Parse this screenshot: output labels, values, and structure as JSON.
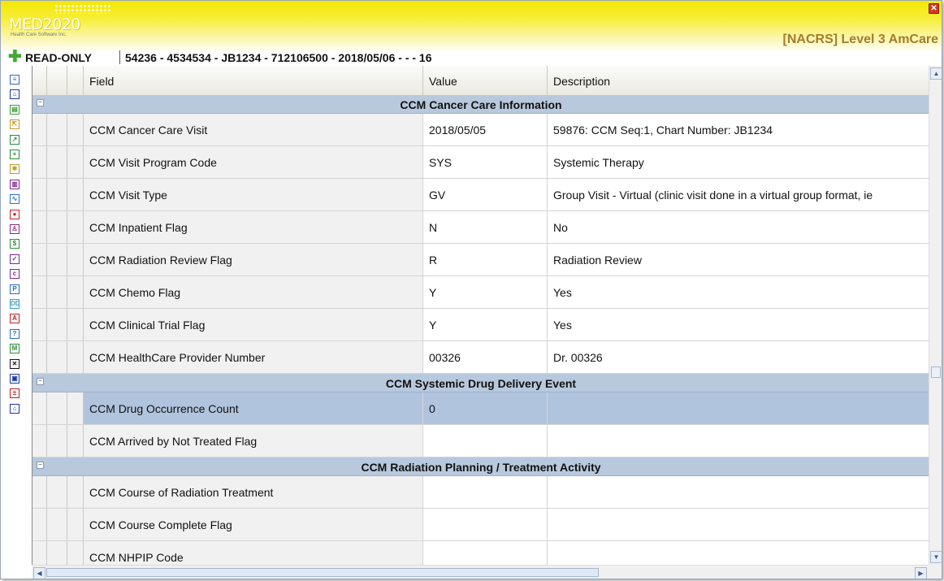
{
  "app": {
    "logo_name": "MED2020",
    "logo_sub": "Health Care Software Inc.",
    "title": "[NACRS] Level 3 AmCare",
    "mode": "READ-ONLY",
    "record_ids": "54236 - 4534534 - JB1234 - 712106500 - 2018/05/06 - - - 16",
    "close_glyph": "✕",
    "add_glyph": "✚"
  },
  "toolbar": {
    "icons": [
      {
        "name": "list-icon",
        "glyph": "≡",
        "color": "#2a6ebb"
      },
      {
        "name": "home-icon",
        "glyph": "⌂",
        "color": "#1e3c9a"
      },
      {
        "name": "map-icon",
        "glyph": "▤",
        "color": "#3f9e3a"
      },
      {
        "name": "export-icon",
        "glyph": "⇱",
        "color": "#c59a21"
      },
      {
        "name": "arrow-icon",
        "glyph": "↗",
        "color": "#2e8b3e"
      },
      {
        "name": "plus-icon",
        "glyph": "+",
        "color": "#2e8b3e"
      },
      {
        "name": "puzzle-icon",
        "glyph": "✱",
        "color": "#b3a238"
      },
      {
        "name": "chart-icon",
        "glyph": "▥",
        "color": "#7b2d8d"
      },
      {
        "name": "wave-icon",
        "glyph": "∿",
        "color": "#2f6fcf"
      },
      {
        "name": "drop-icon",
        "glyph": "●",
        "color": "#cc2222"
      },
      {
        "name": "person-icon",
        "glyph": "♙",
        "color": "#8c2a7a"
      },
      {
        "name": "dollar-icon",
        "glyph": "$",
        "color": "#2e8b3e"
      },
      {
        "name": "check-icon",
        "glyph": "✓",
        "color": "#7b2d8d"
      },
      {
        "name": "c-icon",
        "glyph": "c",
        "color": "#7b2d8d"
      },
      {
        "name": "p-icon",
        "glyph": "P",
        "color": "#2a6ebb"
      },
      {
        "name": "dd-icon",
        "glyph": "DD",
        "color": "#3ba5c8"
      },
      {
        "name": "a-icon",
        "glyph": "A",
        "color": "#c22222"
      },
      {
        "name": "help-icon",
        "glyph": "?",
        "color": "#2a6ebb"
      },
      {
        "name": "m-icon",
        "glyph": "M",
        "color": "#2e8b3e"
      },
      {
        "name": "x-icon",
        "glyph": "✕",
        "color": "#111111"
      },
      {
        "name": "doc-icon",
        "glyph": "▣",
        "color": "#1e3c9a"
      },
      {
        "name": "plusminus-icon",
        "glyph": "±",
        "color": "#c22222"
      },
      {
        "name": "house-icon",
        "glyph": "⌂",
        "color": "#1e3c9a"
      }
    ]
  },
  "grid": {
    "columns": {
      "field": "Field",
      "value": "Value",
      "description": "Description"
    },
    "group_toggle": "−",
    "groups": [
      {
        "title": "CCM Cancer Care Information",
        "rows": [
          {
            "field": "CCM Cancer Care Visit",
            "value": "2018/05/05",
            "desc": "59876: CCM  Seq:1, Chart Number: JB1234"
          },
          {
            "field": "CCM Visit Program Code",
            "value": "SYS",
            "desc": "Systemic Therapy"
          },
          {
            "field": "CCM Visit Type",
            "value": "GV",
            "desc": "Group Visit - Virtual (clinic visit done in a virtual group format, ie"
          },
          {
            "field": "CCM Inpatient Flag",
            "value": "N",
            "desc": "No"
          },
          {
            "field": "CCM Radiation Review Flag",
            "value": "R",
            "desc": "Radiation Review"
          },
          {
            "field": "CCM Chemo Flag",
            "value": "Y",
            "desc": "Yes"
          },
          {
            "field": "CCM Clinical Trial Flag",
            "value": "Y",
            "desc": "Yes"
          },
          {
            "field": "CCM HealthCare Provider Number",
            "value": "00326",
            "desc": "Dr. 00326"
          }
        ]
      },
      {
        "title": "CCM Systemic Drug Delivery Event",
        "rows": [
          {
            "field": "CCM Drug Occurrence Count",
            "value": "0",
            "desc": "",
            "selected": true
          },
          {
            "field": "CCM Arrived by Not Treated Flag",
            "value": "",
            "desc": ""
          }
        ]
      },
      {
        "title": "CCM Radiation Planning / Treatment Activity",
        "rows": [
          {
            "field": "CCM Course of Radiation Treatment",
            "value": "",
            "desc": ""
          },
          {
            "field": "CCM Course Complete Flag",
            "value": "",
            "desc": ""
          },
          {
            "field": "CCM NHPIP Code",
            "value": "",
            "desc": ""
          }
        ]
      }
    ]
  },
  "scroll": {
    "up": "▲",
    "down": "▼",
    "left": "◀",
    "right": "▶",
    "grip": "≡"
  }
}
